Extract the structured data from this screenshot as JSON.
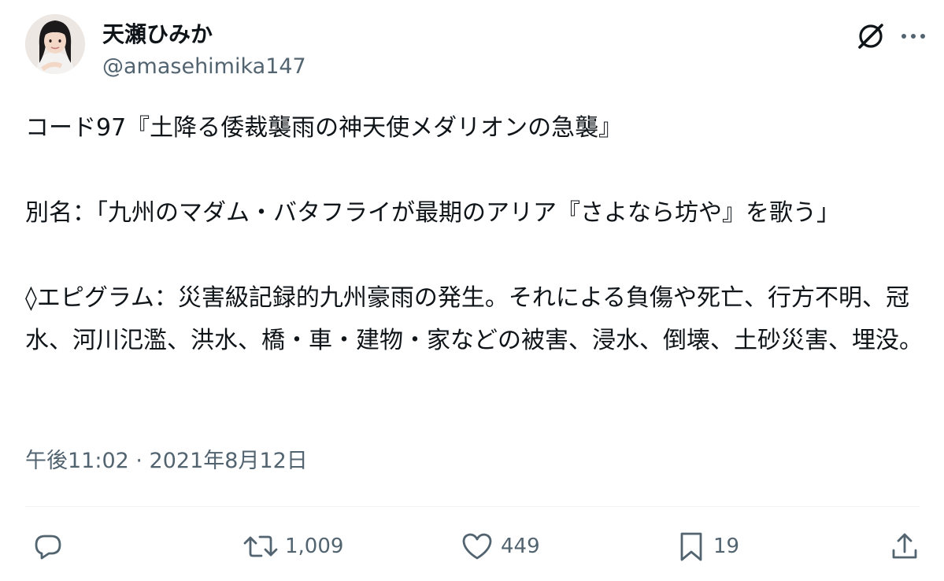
{
  "user": {
    "display_name": "天瀬ひみか",
    "handle": "@amasehimika147"
  },
  "icons": {
    "grok": "grok-slash-circle-icon",
    "more": "more-dots-icon",
    "reply": "reply-bubble-icon",
    "retweet": "retweet-arrows-icon",
    "like": "heart-icon",
    "bookmark": "bookmark-icon",
    "share": "share-upload-icon"
  },
  "tweet": {
    "line1": "コード97『土降る倭裁襲雨の神天使メダリオンの急襲』",
    "line2": "別名：「九州のマダム・バタフライが最期のアリア『さよなら坊や』を歌う」",
    "line3": "◊エピグラム：災害級記録的九州豪雨の発生。それによる負傷や死亡、行方不明、冠水、河川氾濫、洪水、橋・車・建物・家などの被害、浸水、倒壊、土砂災害、埋没。"
  },
  "timestamp": "午後11:02 · 2021年8月12日",
  "actions": {
    "retweets": "1,009",
    "likes": "449",
    "bookmarks": "19"
  },
  "colors": {
    "text": "#0f1419",
    "secondary": "#536471",
    "divider": "#eff3f4",
    "background": "#ffffff"
  }
}
